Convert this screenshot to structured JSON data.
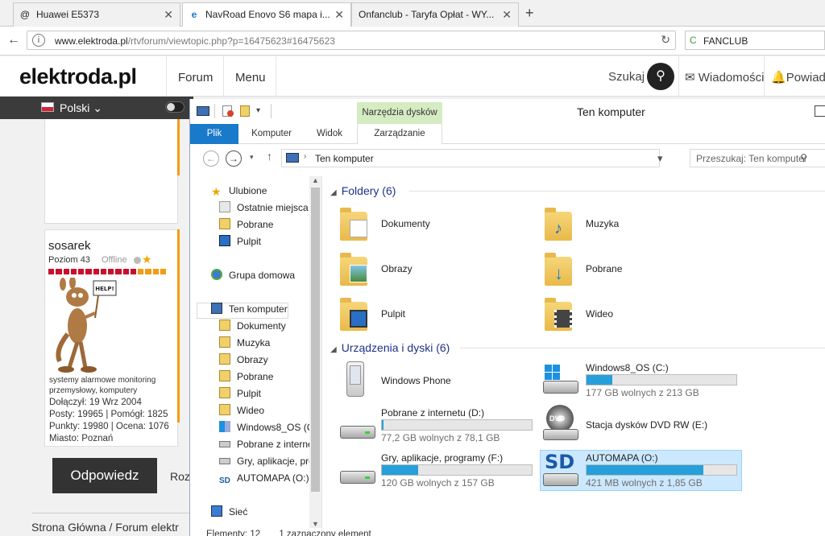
{
  "browser": {
    "tabs": [
      {
        "icon": "@",
        "title": "Huawei E5373"
      },
      {
        "icon": "e",
        "title": "NavRoad Enovo S6 mapa i..."
      },
      {
        "icon": "",
        "title": "Onfanclub - Taryfa Opłat - WY..."
      }
    ],
    "url_domain": "www.elektroda.pl",
    "url_path": "/rtvforum/viewtopic.php?p=16475623#16475623",
    "search_value": "FANCLUB"
  },
  "site": {
    "logo": "elektroda.pl",
    "nav": [
      "Forum",
      "Menu"
    ],
    "search_label": "Szukaj",
    "messages": "Wiadomości",
    "notifications": "Powiado",
    "language": "Polski"
  },
  "post": {
    "username": "sosarek",
    "rank": "Poziom 43",
    "status": "Offline",
    "avatar_sign": "HELP!",
    "description_line1": "systemy alarmowe monitoring",
    "description_line2": "przemysłowy, komputery",
    "joined": "Dołączył: 19 Wrz 2004",
    "posts": "Posty: 19965 | Pomógł: 1825",
    "points": "Punkty: 19980 | Ocena: 1076",
    "city": "Miasto: Poznań",
    "reply_button": "Odpowiedz",
    "second_button": "Roz"
  },
  "breadcrumb": "Strona Główna  /  Forum elektr",
  "explorer": {
    "title": "Ten komputer",
    "context_tab": "Narzędzia dysków",
    "ribbon_tabs": [
      "Plik",
      "Komputer",
      "Widok",
      "Zarządzanie"
    ],
    "address": "Ten komputer",
    "search_placeholder": "Przeszukaj: Ten komputer",
    "nav_items": [
      "Ulubione",
      "Ostatnie miejsca",
      "Pobrane",
      "Pulpit",
      "Grupa domowa",
      "Ten komputer",
      "Dokumenty",
      "Muzyka",
      "Obrazy",
      "Pobrane",
      "Pulpit",
      "Wideo",
      "Windows8_OS (C",
      "Pobrane z interne",
      "Gry, aplikacje, pro",
      "AUTOMAPA (O:)",
      "Sieć"
    ],
    "folders_header": "Foldery (6)",
    "folders": [
      "Dokumenty",
      "Muzyka",
      "Obrazy",
      "Pobrane",
      "Pulpit",
      "Wideo"
    ],
    "devices_header": "Urządzenia i dyski (6)",
    "devices": [
      {
        "name": "Windows Phone"
      },
      {
        "name": "Windows8_OS (C:)",
        "free": "177 GB wolnych z 213 GB",
        "used_fraction": 0.17
      },
      {
        "name": "Pobrane z internetu (D:)",
        "free": "77,2 GB wolnych z 78,1 GB",
        "used_fraction": 0.01
      },
      {
        "name": "Stacja dysków DVD RW (E:)",
        "dvd_label": "DVD"
      },
      {
        "name": "Gry, aplikacje, programy (F:)",
        "free": "120 GB wolnych z 157 GB",
        "used_fraction": 0.24
      },
      {
        "name": "AUTOMAPA (O:)",
        "free": "421 MB wolnych z 1,85 GB",
        "used_fraction": 0.78,
        "sd_label": "SD"
      }
    ],
    "status_items": "Elementy: 12",
    "status_selected": "1 zaznaczony element"
  },
  "colors": {
    "accent_blue": "#1979ca",
    "drive_bar": "#26a0da",
    "context_tab_green": "#d5ecc3",
    "group_header": "#1e3287"
  }
}
